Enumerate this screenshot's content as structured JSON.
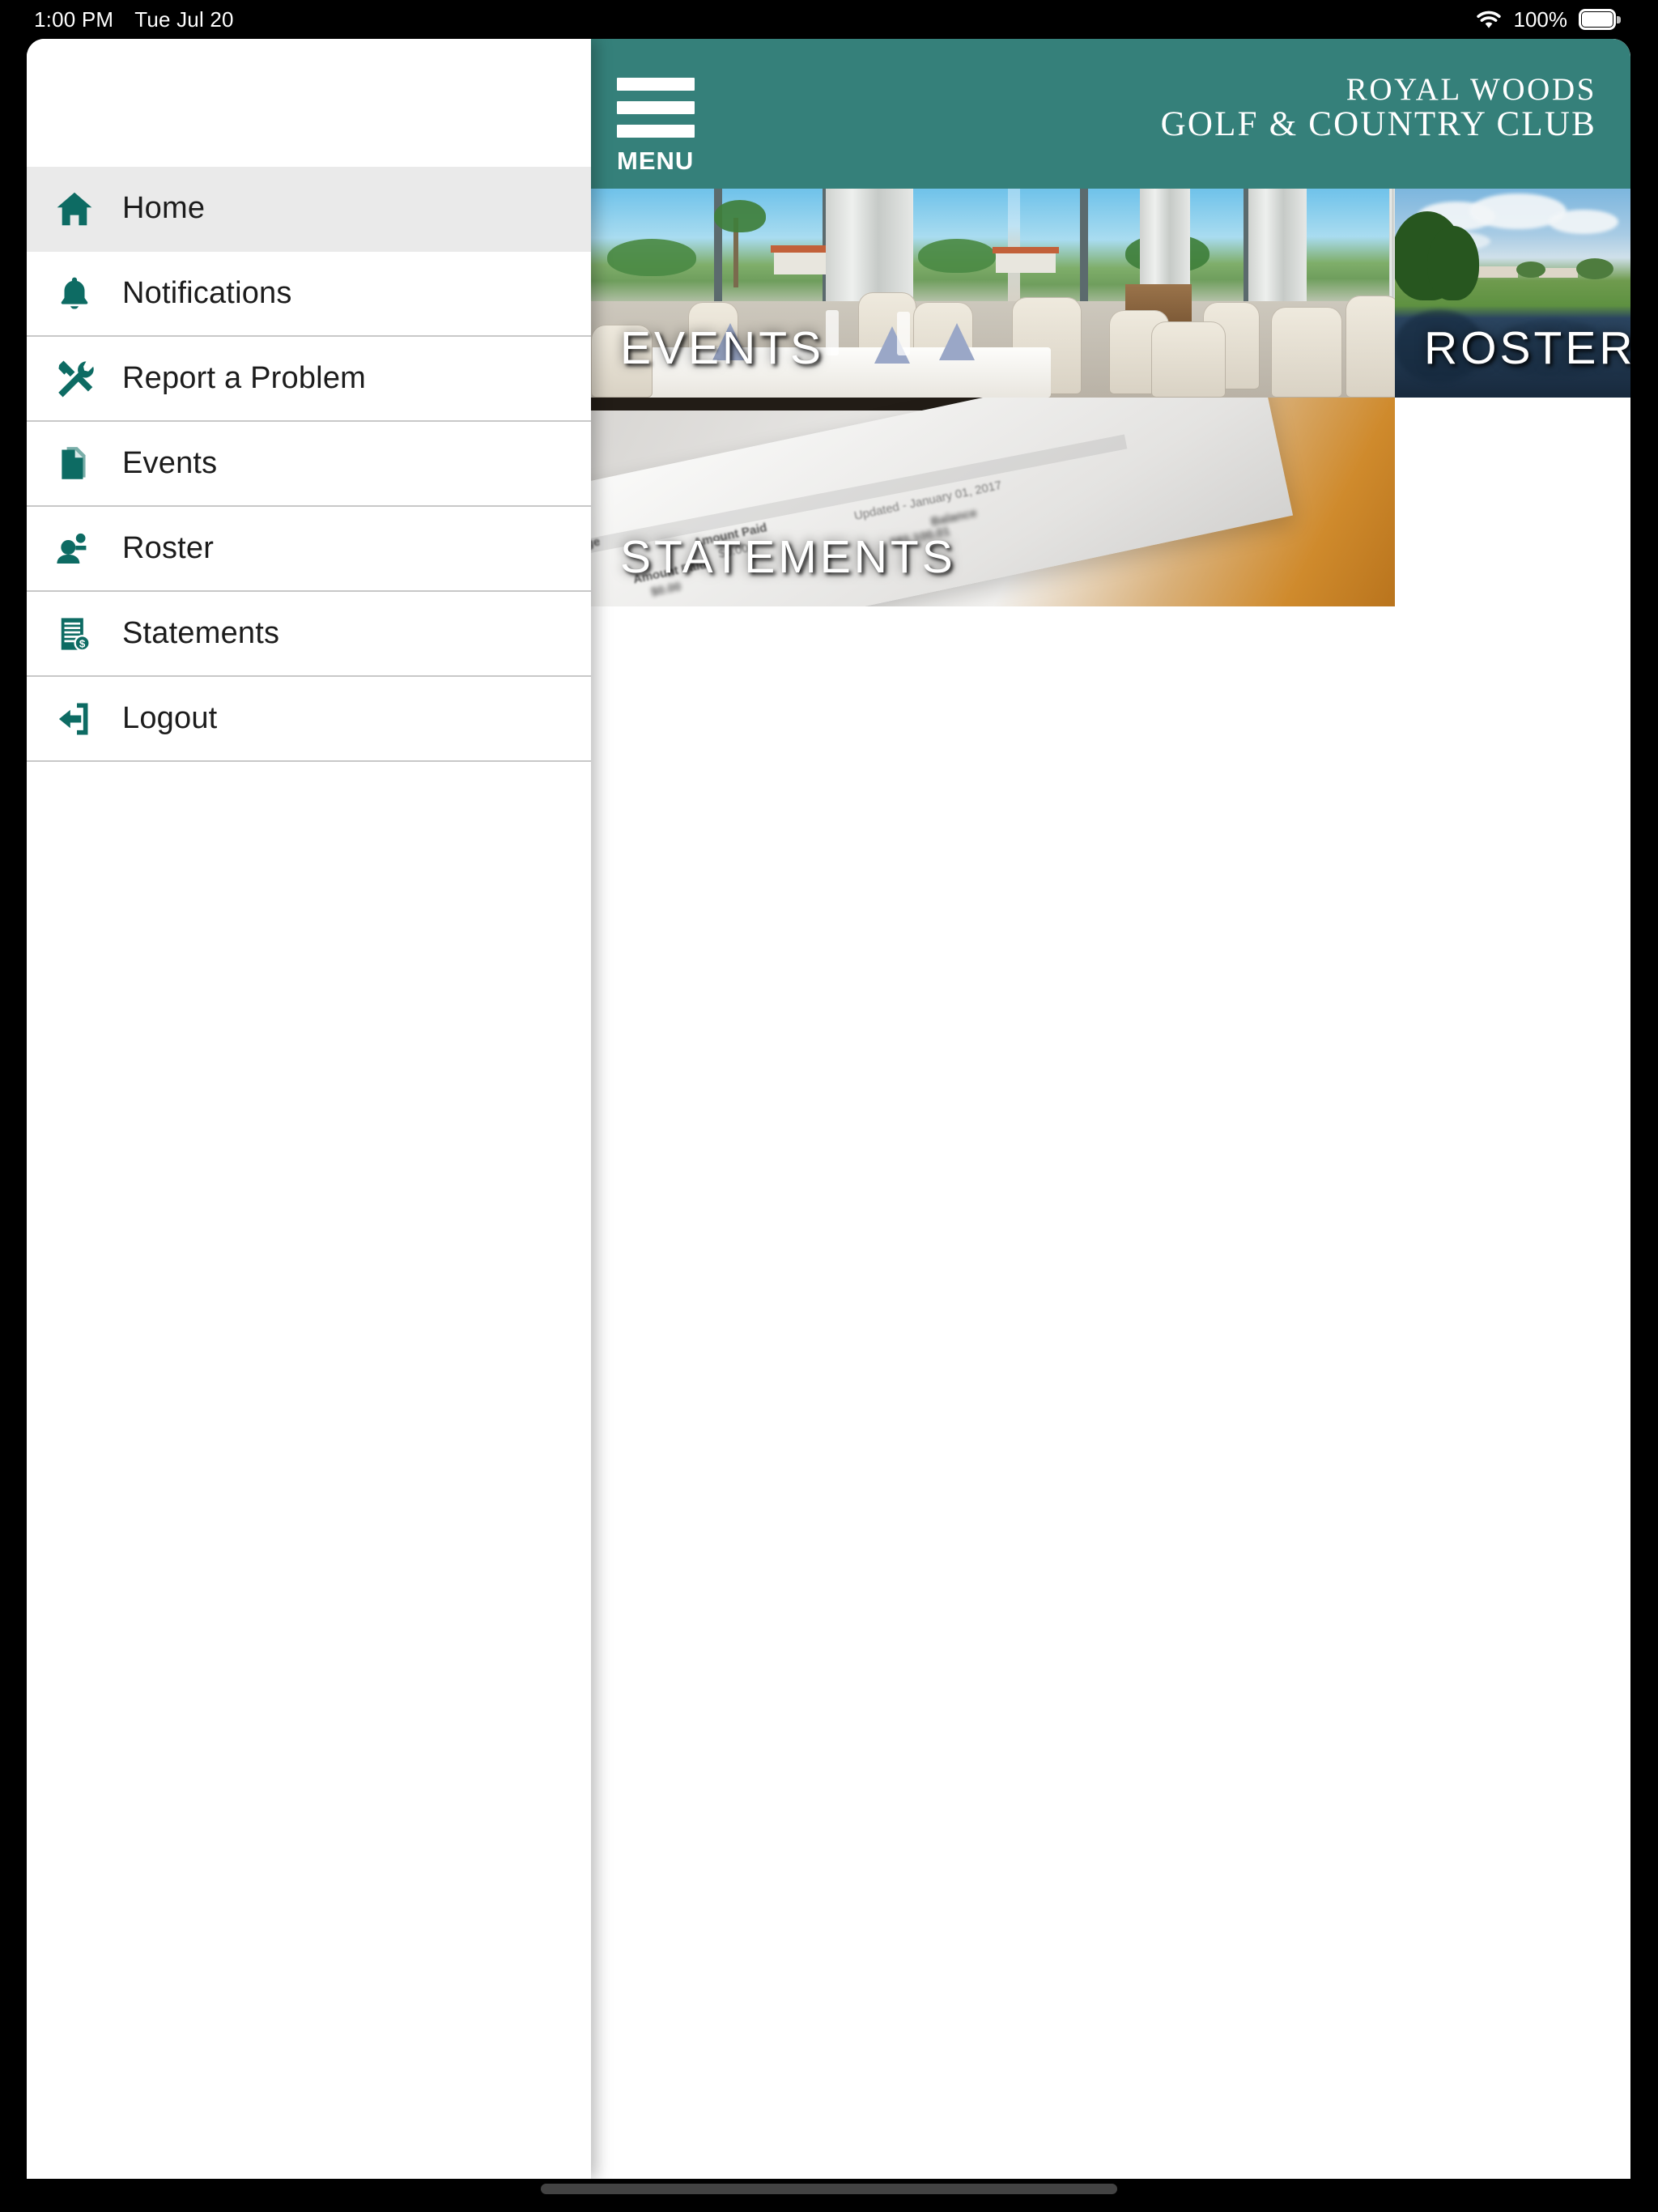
{
  "status_bar": {
    "time": "1:00 PM",
    "date": "Tue Jul 20",
    "battery_percent": "100%",
    "wifi_icon": "wifi-icon",
    "battery_icon": "battery-full-icon"
  },
  "header": {
    "menu_label": "MENU",
    "menu_icon": "hamburger-icon",
    "brand_line1": "ROYAL WOODS",
    "brand_line2": "GOLF & COUNTRY CLUB",
    "background_color": "#35807a"
  },
  "sidebar": {
    "items": [
      {
        "label": "Home",
        "icon": "home-icon",
        "selected": true
      },
      {
        "label": "Notifications",
        "icon": "bell-icon",
        "selected": false
      },
      {
        "label": "Report a Problem",
        "icon": "tools-icon",
        "selected": false
      },
      {
        "label": "Events",
        "icon": "documents-icon",
        "selected": false
      },
      {
        "label": "Roster",
        "icon": "people-icon",
        "selected": false
      },
      {
        "label": "Statements",
        "icon": "invoice-usd-icon",
        "selected": false
      },
      {
        "label": "Logout",
        "icon": "logout-icon",
        "selected": false
      }
    ],
    "icon_color": "#0d6b63",
    "selected_background": "#eaeaea"
  },
  "main": {
    "cards": [
      {
        "label": "EVENTS",
        "photo": "banquet-dining-room"
      },
      {
        "label": "ROSTER",
        "photo": "golf-course-lake"
      },
      {
        "label": "STATEMENTS",
        "photo": "invoice-on-desk"
      }
    ]
  },
  "statement_photo_text": {
    "charge": "Charge",
    "charge_amount": "$0.00",
    "amount_paid_1": "Amount Paid",
    "amount_paid_1_value": "$0.00",
    "amount_paid_2": "Amount Paid",
    "updated": "Updated - January 01, 2017",
    "balance": "Balance"
  }
}
